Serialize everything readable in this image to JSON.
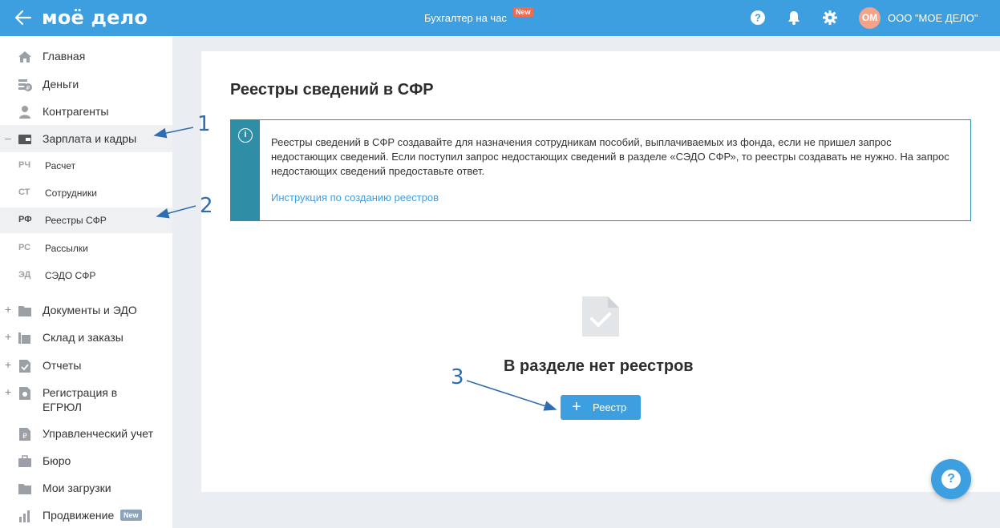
{
  "header": {
    "logo": "моё дело",
    "center_link": "Бухгалтер на час",
    "new_badge": "New",
    "avatar_initials": "ОМ",
    "org_name": "ООО \"МОЕ ДЕЛО\""
  },
  "sidebar": {
    "items": [
      {
        "label": "Главная",
        "icon": "home-icon"
      },
      {
        "label": "Деньги",
        "icon": "money-icon"
      },
      {
        "label": "Контрагенты",
        "icon": "contractors-icon"
      },
      {
        "label": "Зарплата и кадры",
        "icon": "wallet-icon",
        "toggle": "–"
      },
      {
        "label": "Документы и ЭДО",
        "icon": "folder-icon",
        "toggle": "+"
      },
      {
        "label": "Склад и заказы",
        "icon": "warehouse-icon",
        "toggle": "+"
      },
      {
        "label": "Отчеты",
        "icon": "report-icon",
        "toggle": "+"
      },
      {
        "label": "Регистрация в ЕГРЮЛ",
        "label_line1": "Регистрация в",
        "label_line2": "ЕГРЮЛ",
        "icon": "registration-icon",
        "toggle": "+"
      },
      {
        "label": "Управленческий учет",
        "icon": "ruble-doc-icon"
      },
      {
        "label": "Бюро",
        "icon": "briefcase-icon"
      },
      {
        "label": "Мои загрузки",
        "icon": "folder-icon"
      },
      {
        "label": "Продвижение",
        "icon": "chart-icon",
        "badge": "New"
      }
    ],
    "subitems": [
      {
        "abbr": "РЧ",
        "label": "Расчет"
      },
      {
        "abbr": "СТ",
        "label": "Сотрудники"
      },
      {
        "abbr": "РФ",
        "label": "Реестры СФР"
      },
      {
        "abbr": "РС",
        "label": "Рассылки"
      },
      {
        "abbr": "ЭД",
        "label": "СЭДО СФР"
      }
    ]
  },
  "main": {
    "title": "Реестры сведений в СФР",
    "info_text": "Реестры сведений в СФР создавайте для назначения сотрудникам пособий, выплачиваемых из фонда, если не пришел запрос недостающих сведений. Если поступил запрос недостающих сведений в разделе «СЭДО СФР», то реестры создавать не нужно. На запрос недостающих сведений предоставьте ответ.",
    "info_link": "Инструкция по созданию реестров",
    "empty_title": "В разделе нет реестров",
    "add_button": "Реестр"
  },
  "annotations": [
    "1",
    "2",
    "3"
  ],
  "colors": {
    "accent": "#3d9fe0",
    "info": "#2f8da6",
    "badge_new": "#f26b4f",
    "annotation": "#2f6db3"
  }
}
